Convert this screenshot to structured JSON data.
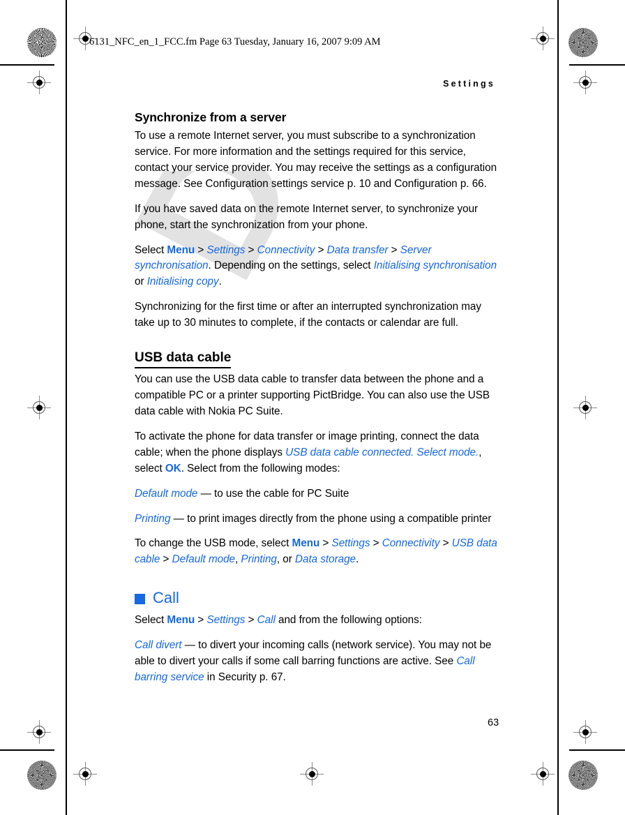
{
  "page": {
    "fm_header": "6131_NFC_en_1_FCC.fm  Page 63  Tuesday, January 16, 2007  9:09 AM",
    "running_head": "Settings",
    "page_number": "63",
    "watermark": "DRAFT",
    "accent_color": "#1668e3"
  },
  "sections": {
    "sync_server": {
      "heading": "Synchronize from a server",
      "para1": "To use a remote Internet server, you must subscribe to a synchronization service. For more information and the settings required for this service, contact your service provider. You may receive the settings as a configuration message. See Configuration settings service p. 10 and Configuration p. 66.",
      "para2": "If you have saved data on the remote Internet server, to synchronize your phone, start the synchronization from your phone.",
      "path_intro": "Select",
      "path": {
        "menu": "Menu",
        "settings": "Settings",
        "connectivity": "Connectivity",
        "data_transfer": "Data transfer",
        "server_sync": "Server synchronisation",
        "sep": ">"
      },
      "path_tail_1": ". Depending on the settings, select",
      "option_init_sync": "Initialising synchronisation",
      "path_or": "or",
      "option_init_copy": "Initialising copy",
      "path_tail_2": ".",
      "para3": "Synchronizing for the first time or after an interrupted synchronization may take up to 30 minutes to complete, if the contacts or calendar are full."
    },
    "usb_data_cable": {
      "heading": "USB data cable",
      "para1": "You can use the USB data cable to transfer data between the phone and a compatible PC or a printer supporting PictBridge. You can also use the USB data cable with Nokia PC Suite.",
      "activate_lead": "To activate the phone for data transfer or image printing, connect the data cable; when the phone displays",
      "activate_msg": "USB data cable connected. Select mode.",
      "activate_mid": ", select",
      "activate_ok": "OK",
      "activate_tail": ". Select from the following modes:",
      "mode_default": "Default mode",
      "mode_default_desc": "— to use the cable for PC Suite",
      "mode_printing": "Printing",
      "mode_printing_desc": "— to print images directly from the phone using a compatible printer",
      "change_lead": "To change the USB mode, select",
      "change_path": {
        "menu": "Menu",
        "settings": "Settings",
        "connectivity": "Connectivity",
        "usb_data_cable": "USB data cable",
        "default_mode": "Default mode",
        "printing": "Printing",
        "data_storage": "Data storage",
        "sep": ">",
        "comma": ",",
        "or": ", or",
        "period": "."
      }
    },
    "call": {
      "heading": "Call",
      "select_lead": "Select",
      "path": {
        "menu": "Menu",
        "settings": "Settings",
        "call": "Call",
        "sep": ">"
      },
      "select_tail": "and from the following options:",
      "call_divert": "Call divert",
      "call_divert_desc_1": "— to divert your incoming calls (network service). You may not be able to divert your calls if some call barring functions are active. See",
      "call_barring_service": "Call barring service",
      "call_divert_desc_2": "in Security p. 67."
    }
  }
}
